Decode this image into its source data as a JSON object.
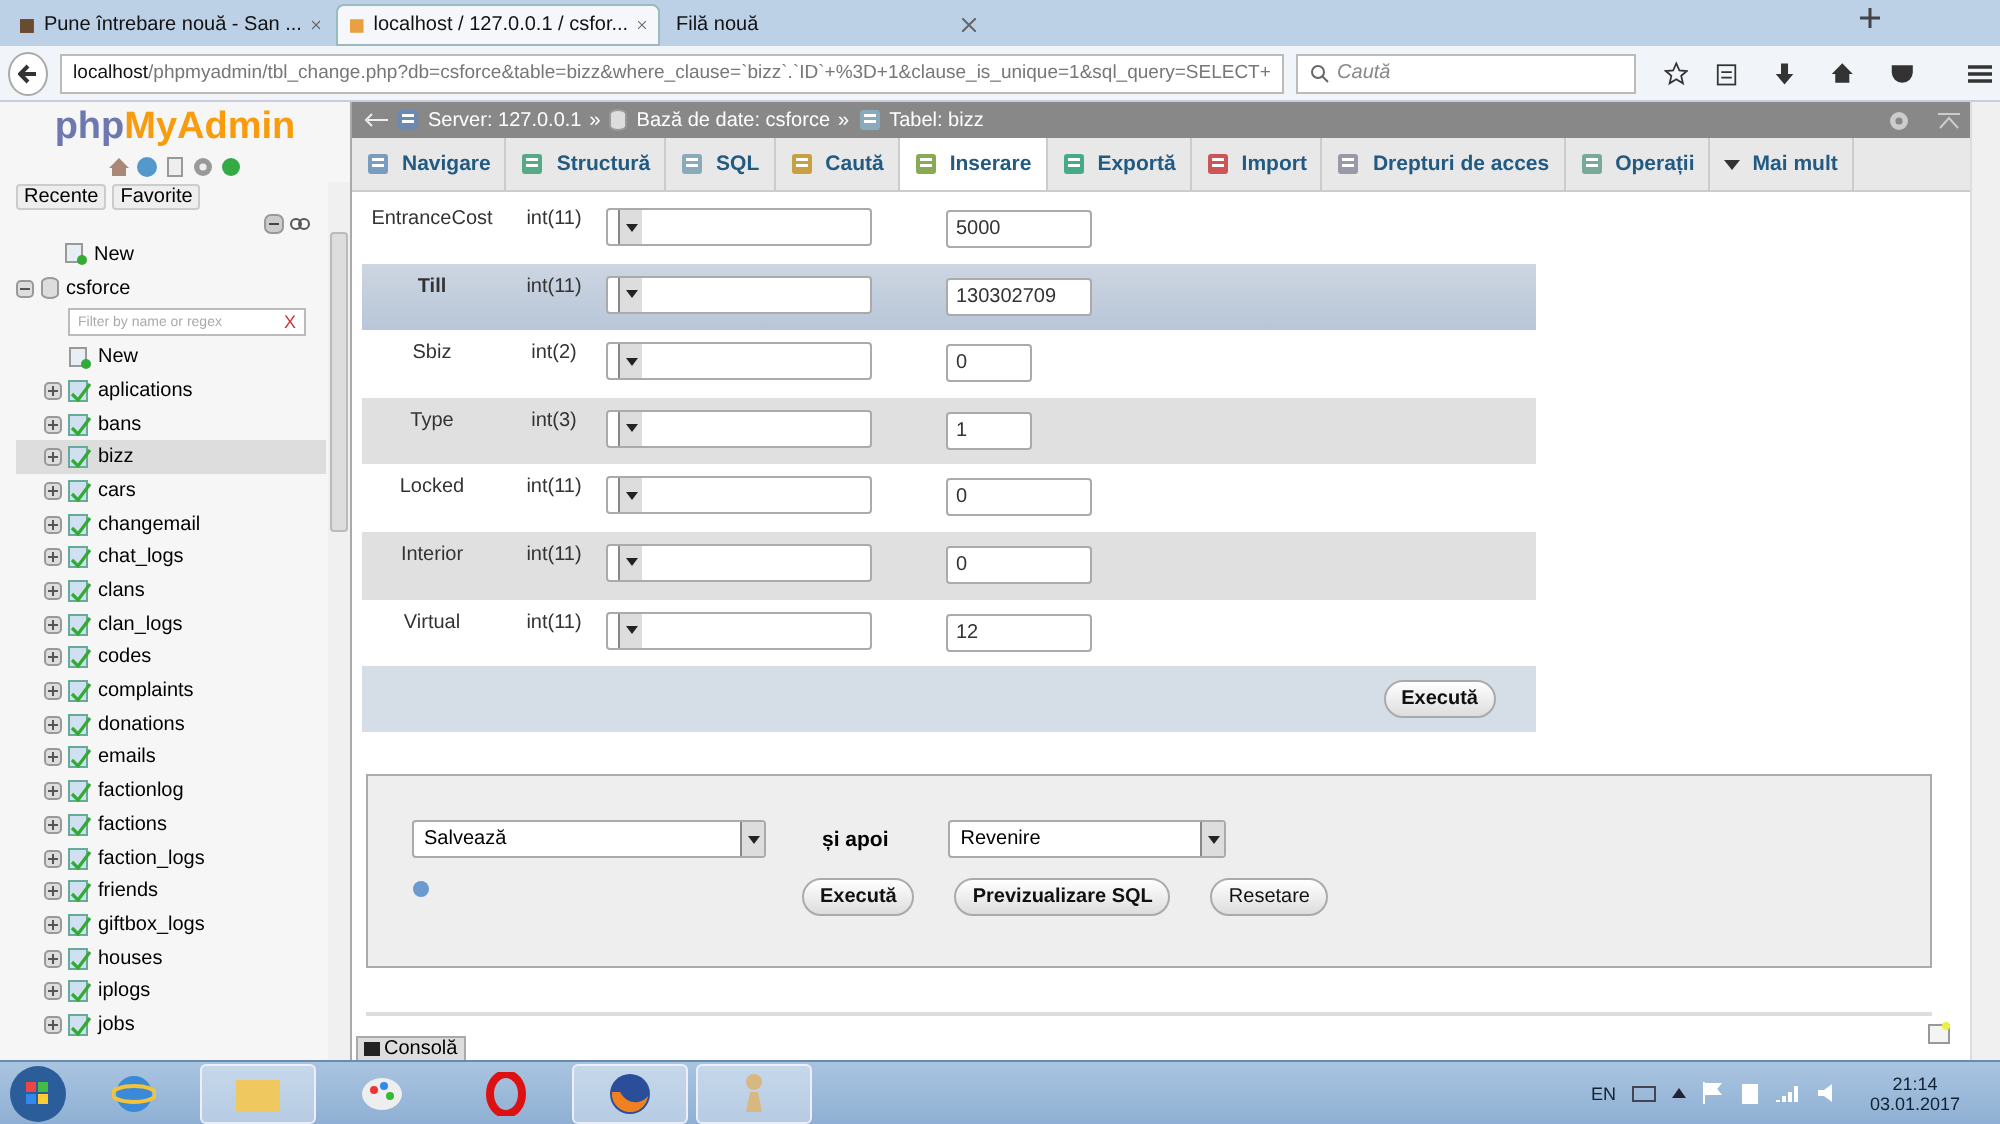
{
  "browser": {
    "tabs": [
      {
        "title": "Pune întrebare nouă - San ...",
        "selected": false,
        "icon": true
      },
      {
        "title": "localhost / 127.0.0.1 / csfor...",
        "selected": true,
        "icon": true
      },
      {
        "title": "Filă nouă",
        "selected": false,
        "icon": false
      }
    ],
    "url_host": "localhost",
    "url_path": "/phpmyadmin/tbl_change.php?db=csforce&table=bizz&where_clause=`bizz`.`ID`+%3D+1&clause_is_unique=1&sql_query=SELECT+",
    "search_placeholder": "Caută"
  },
  "sidebar": {
    "logo_php": "php",
    "logo_name": "MyAdmin",
    "tabs": [
      "Recente",
      "Favorite"
    ],
    "tree": [
      {
        "label": "New",
        "kind": "new"
      },
      {
        "label": "csforce",
        "kind": "db",
        "expanded": true,
        "filter_placeholder": "Filter by name or regex",
        "clear": "X",
        "children": [
          {
            "label": "New",
            "kind": "new",
            "selected": false
          },
          {
            "label": "aplications",
            "kind": "table",
            "selected": false
          },
          {
            "label": "bans",
            "kind": "table",
            "selected": false
          },
          {
            "label": "bizz",
            "kind": "table",
            "selected": true
          },
          {
            "label": "cars",
            "kind": "table",
            "selected": false
          },
          {
            "label": "changemail",
            "kind": "table",
            "selected": false
          },
          {
            "label": "chat_logs",
            "kind": "table",
            "selected": false
          },
          {
            "label": "clans",
            "kind": "table",
            "selected": false
          },
          {
            "label": "clan_logs",
            "kind": "table",
            "selected": false
          },
          {
            "label": "codes",
            "kind": "table",
            "selected": false
          },
          {
            "label": "complaints",
            "kind": "table",
            "selected": false
          },
          {
            "label": "donations",
            "kind": "table",
            "selected": false
          },
          {
            "label": "emails",
            "kind": "table",
            "selected": false
          },
          {
            "label": "factionlog",
            "kind": "table",
            "selected": false
          },
          {
            "label": "factions",
            "kind": "table",
            "selected": false
          },
          {
            "label": "faction_logs",
            "kind": "table",
            "selected": false
          },
          {
            "label": "friends",
            "kind": "table",
            "selected": false
          },
          {
            "label": "giftbox_logs",
            "kind": "table",
            "selected": false
          },
          {
            "label": "houses",
            "kind": "table",
            "selected": false
          },
          {
            "label": "iplogs",
            "kind": "table",
            "selected": false
          },
          {
            "label": "jobs",
            "kind": "table",
            "selected": false
          }
        ]
      }
    ]
  },
  "breadcrumb": {
    "server": "Server: 127.0.0.1",
    "database": "Bază de date: csforce",
    "table": "Tabel: bizz",
    "sep": "»"
  },
  "menu": [
    {
      "label": "Navigare",
      "selected": false
    },
    {
      "label": "Structură",
      "selected": false
    },
    {
      "label": "SQL",
      "selected": false
    },
    {
      "label": "Caută",
      "selected": false
    },
    {
      "label": "Inserare",
      "selected": true
    },
    {
      "label": "Exportă",
      "selected": false
    },
    {
      "label": "Import",
      "selected": false
    },
    {
      "label": "Drepturi de acces",
      "selected": false
    },
    {
      "label": "Operații",
      "selected": false
    },
    {
      "label": "Mai mult",
      "selected": false
    }
  ],
  "rows": [
    {
      "name": "EntranceCost",
      "type": "int(11)",
      "value": "5000",
      "kind": "long",
      "selected": false
    },
    {
      "name": "Till",
      "type": "int(11)",
      "value": "130302709",
      "kind": "long",
      "selected": true
    },
    {
      "name": "Sbiz",
      "type": "int(2)",
      "value": "0",
      "kind": "short",
      "selected": false
    },
    {
      "name": "Type",
      "type": "int(3)",
      "value": "1",
      "kind": "short",
      "selected": false
    },
    {
      "name": "Locked",
      "type": "int(11)",
      "value": "0",
      "kind": "long",
      "selected": false
    },
    {
      "name": "Interior",
      "type": "int(11)",
      "value": "0",
      "kind": "long",
      "selected": false
    },
    {
      "name": "Virtual",
      "type": "int(11)",
      "value": "12",
      "kind": "long",
      "selected": false
    }
  ],
  "table_button": "Execută",
  "options": {
    "action": "Salvează",
    "then": "și apoi",
    "after": "Revenire",
    "buttons": [
      {
        "label": "Execută",
        "kind": "primary"
      },
      {
        "label": "Previzualizare SQL",
        "kind": "primary"
      },
      {
        "label": "Resetare",
        "kind": "secondary"
      }
    ]
  },
  "console": "Consolă",
  "taskbar": {
    "lang": "EN",
    "time": "21:14",
    "date": "03.01.2017"
  }
}
